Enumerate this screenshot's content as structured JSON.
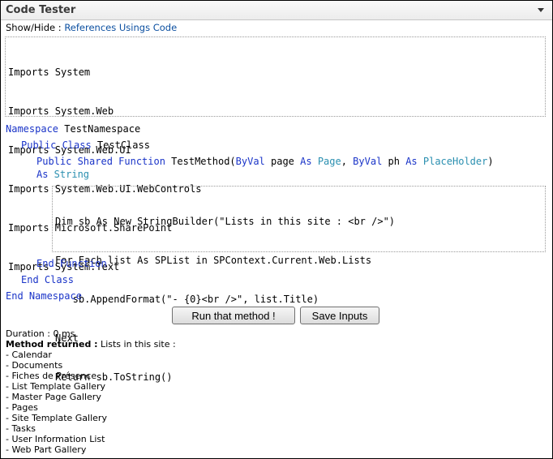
{
  "header": {
    "title": "Code Tester",
    "menu_icon": "chevron-down-icon"
  },
  "toggle": {
    "prefix": "Show/Hide : ",
    "links": [
      "References",
      "Usings",
      "Code"
    ]
  },
  "imports": [
    "Imports System",
    "Imports System.Web",
    "Imports System.Web.UI",
    "Imports System.Web.UI.WebControls",
    "Imports Microsoft.SharePoint",
    "Imports System.Text"
  ],
  "code": {
    "namespace_kw": "Namespace",
    "namespace_name": " TestNamespace",
    "class_kw": "Public Class",
    "class_name": " TestClass",
    "method_kw": "Public Shared Function",
    "method_name": " TestMethod(",
    "byval1": "ByVal",
    "param1": " page ",
    "as1": "As",
    "type1": " Page",
    "comma": ", ",
    "byval2": "ByVal",
    "param2": " ph ",
    "as2": "As",
    "type2": " PlaceHolder",
    "close_paren": ")",
    "return_as": "As",
    "return_type": " String",
    "body_lines": [
      "Dim sb As New StringBuilder(\"Lists in this site : <br />\")",
      "For Each list As SPList in SPContext.Current.Web.Lists",
      "   sb.AppendFormat(\"- {0}<br />\", list.Title)",
      "Next",
      "Return sb.ToString()"
    ],
    "end_function": "End Function",
    "end_class": "End Class",
    "end_namespace": "End Namespace"
  },
  "buttons": {
    "run": "Run that method !",
    "save": "Save Inputs"
  },
  "result": {
    "duration": "Duration : 0 ms",
    "returned_label": "Method returned :",
    "returned_text": " Lists in this site :",
    "items": [
      "- Calendar",
      "- Documents",
      "- Fiches de Présence",
      "- List Template Gallery",
      "- Master Page Gallery",
      "- Pages",
      "- Site Template Gallery",
      "- Tasks",
      "- User Information List",
      "- Web Part Gallery"
    ]
  },
  "colors": {
    "keyword": "#1a34c8",
    "type": "#2a8fb0",
    "link": "#0b4fa0"
  }
}
